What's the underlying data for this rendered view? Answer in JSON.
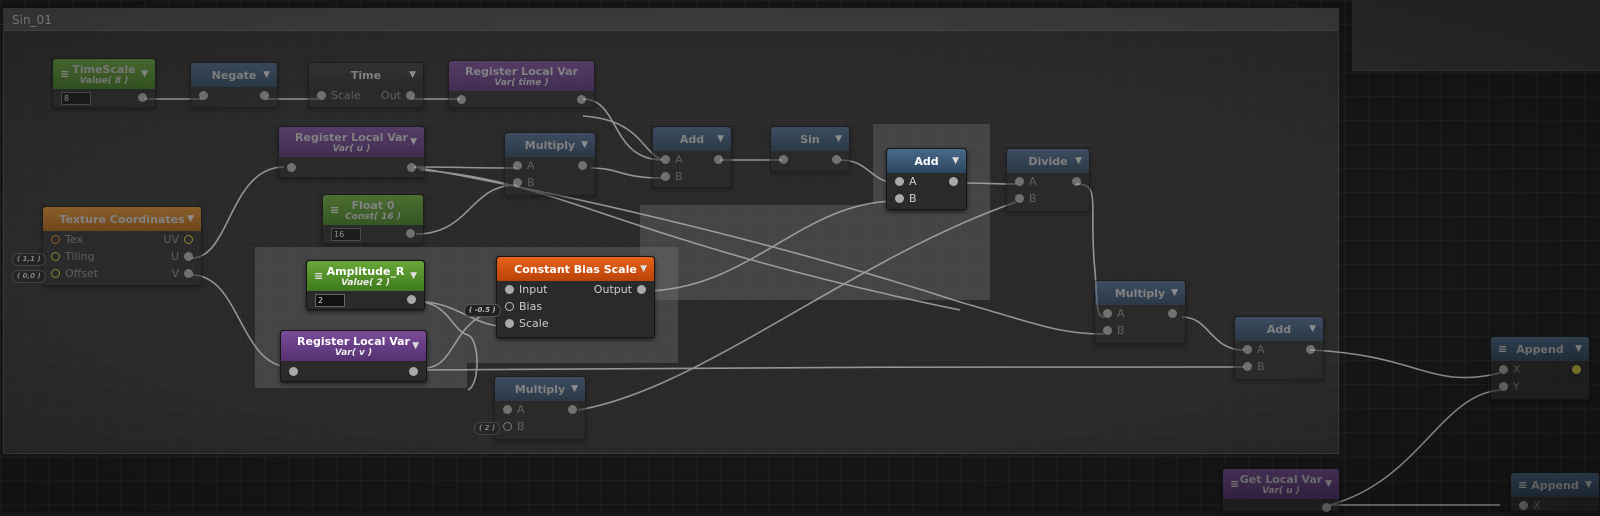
{
  "group": {
    "title": "Sin_01"
  },
  "nodes": {
    "timescale": {
      "title": "TimeScale",
      "subtitle": "Value( 8 )",
      "field": "8"
    },
    "negate": {
      "title": "Negate"
    },
    "time": {
      "title": "Time",
      "in": "Scale",
      "out": "Out"
    },
    "reg_time": {
      "title": "Register Local Var",
      "subtitle": "Var( time )"
    },
    "reg_u": {
      "title": "Register Local Var",
      "subtitle": "Var( u )"
    },
    "multiply1": {
      "title": "Multiply",
      "a": "A",
      "b": "B"
    },
    "add1": {
      "title": "Add",
      "a": "A",
      "b": "B"
    },
    "sin": {
      "title": "Sin"
    },
    "add2": {
      "title": "Add",
      "a": "A",
      "b": "B"
    },
    "divide": {
      "title": "Divide",
      "a": "A",
      "b": "B"
    },
    "float0": {
      "title": "Float 0",
      "subtitle": "Const( 16 )",
      "field": "16"
    },
    "texcoord": {
      "title": "Texture Coordinates",
      "tex": "Tex",
      "tiling": "Tiling",
      "offset": "Offset",
      "uv": "UV",
      "u": "U",
      "v": "V",
      "tiling_ext": "( 1,1 )",
      "offset_ext": "( 0,0 )"
    },
    "amplitude": {
      "title": "Amplitude_R",
      "subtitle": "Value( 2 )",
      "field": "2"
    },
    "cbs": {
      "title": "Constant Bias Scale",
      "input": "Input",
      "bias": "Bias",
      "scale": "Scale",
      "output": "Output",
      "bias_ext": "( -0.5 )"
    },
    "reg_v": {
      "title": "Register Local Var",
      "subtitle": "Var( v )"
    },
    "multiply2": {
      "title": "Multiply",
      "a": "A",
      "b": "B",
      "b_ext": "( 2 )"
    },
    "multiply3": {
      "title": "Multiply",
      "a": "A",
      "b": "B"
    },
    "add3": {
      "title": "Add",
      "a": "A",
      "b": "B"
    },
    "append1": {
      "title": "Append",
      "x": "X",
      "y": "Y"
    },
    "getlocal": {
      "title": "Get Local Var",
      "subtitle": "Var( u )"
    },
    "append2": {
      "title": "Append",
      "x": "X"
    }
  },
  "colors": {
    "wire": "#b8b8b8",
    "canvas": "#161616",
    "group": "#3c3c3c"
  }
}
